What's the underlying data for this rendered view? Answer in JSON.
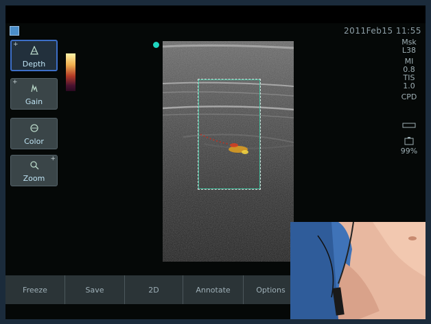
{
  "header": {
    "datetime": "2011Feb15 11:55"
  },
  "side_buttons": [
    {
      "label": "Depth",
      "icon": "depth-icon",
      "corner": "+",
      "active": true
    },
    {
      "label": "Gain",
      "icon": "gain-icon",
      "corner": "+"
    },
    {
      "label": "Color",
      "icon": "color-icon"
    },
    {
      "label": "Zoom",
      "icon": "zoom-icon",
      "corner_right": "+"
    }
  ],
  "right_panel": {
    "preset": "Msk",
    "probe": "L38",
    "mi_label": "MI",
    "mi_value": "0.8",
    "tis_label": "TIS",
    "tis_value": "1.0",
    "mode": "CPD",
    "battery": "99%"
  },
  "bottom_buttons": [
    "Freeze",
    "Save",
    "2D",
    "Annotate",
    "Options"
  ],
  "colors": {
    "accent": "#3d6fc8",
    "roi": "#3ad0a8",
    "doppler": "#e06020",
    "background": "#050807"
  }
}
